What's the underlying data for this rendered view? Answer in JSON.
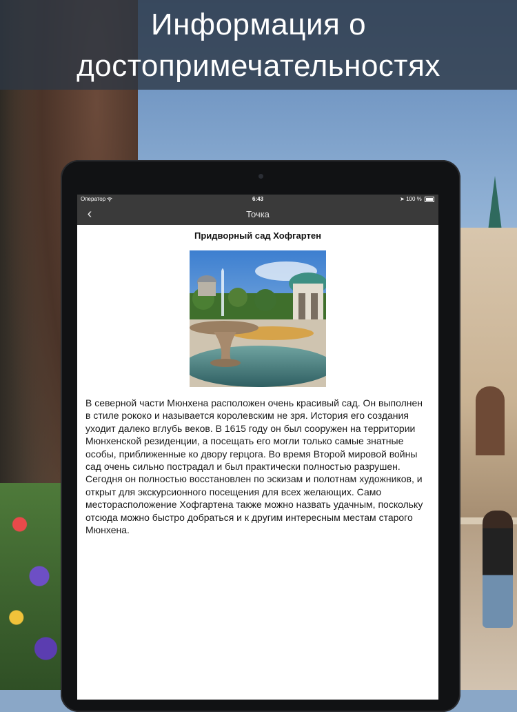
{
  "headline": {
    "line1": "Информация о",
    "line2": "достопримечательностях"
  },
  "status_bar": {
    "carrier": "Оператор",
    "time": "6:43",
    "battery": "100 %"
  },
  "nav": {
    "title": "Точка",
    "back_icon": "chevron-left-icon"
  },
  "article": {
    "title": "Придворный сад Хофгартен",
    "description": "В северной части Мюнхена расположен очень красивый сад. Он выполнен в стиле рококо и называется королевским не зря. История его создания уходит далеко вглубь веков. В 1615 году он был сооружен на территории Мюнхенской резиденции, а посещать его могли только самые знатные особы, приближенные ко двору герцога. Во время Второй мировой войны сад очень сильно пострадал и был практически полностью разрушен. Сегодня он полностью восстановлен по эскизам и полотнам художников, и открыт для экскурсионного посещения для всех желающих. Само месторасположение Хофгартена также можно назвать удачным, поскольку отсюда можно быстро добраться и к другим интересным местам старого Мюнхена."
  },
  "colors": {
    "banner": "#2d3744",
    "navbar": "#3a3a3a",
    "tablet_frame": "#111214"
  }
}
